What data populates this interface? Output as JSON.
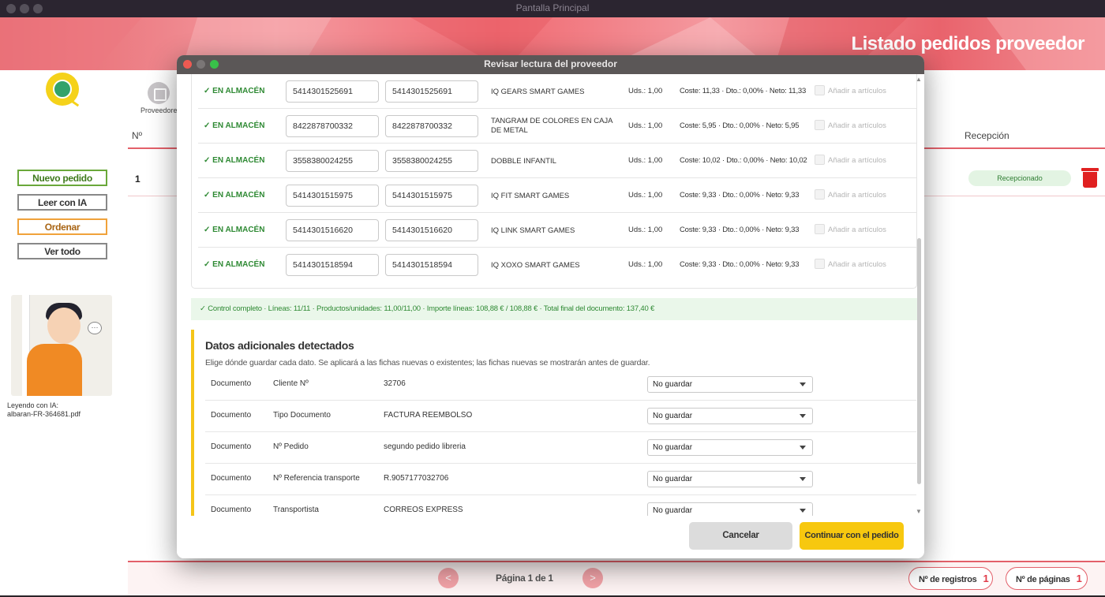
{
  "window": {
    "title": "Pantalla Principal"
  },
  "banner": {
    "title": "Listado pedidos proveedor"
  },
  "nav": {
    "proveedores_label": "Proveedores"
  },
  "table": {
    "col_no": "Nº",
    "col_recepcion": "Recepción",
    "rows": [
      {
        "no": "1",
        "status": "Recepcionado"
      }
    ]
  },
  "sidebar": {
    "nuevo_pedido": "Nuevo pedido",
    "leer_ia": "Leer con IA",
    "ordenar": "Ordenar",
    "ver_todo": "Ver todo",
    "reading_label": "Leyendo con IA:",
    "reading_file": "albaran-FR-364681.pdf"
  },
  "pagination": {
    "prev": "<",
    "next": ">",
    "page_text": "Página 1 de 1",
    "registros_label": "Nº de registros",
    "registros_value": "1",
    "paginas_label": "Nº de páginas",
    "paginas_value": "1"
  },
  "modal": {
    "title": "Revisar lectura del proveedor",
    "lines": [
      {
        "status": "✓ EN ALMACÉN",
        "code1": "5414301525691",
        "code2": "5414301525691",
        "desc": "IQ GEARS SMART GAMES",
        "uds": "Uds.: 1,00",
        "cost": "Coste: 11,33 · Dto.: 0,00% · Neto: 11,33",
        "add": "Añadir a artículos"
      },
      {
        "status": "✓ EN ALMACÉN",
        "code1": "8422878700332",
        "code2": "8422878700332",
        "desc": "TANGRAM DE COLORES EN CAJA DE METAL",
        "uds": "Uds.: 1,00",
        "cost": "Coste: 5,95 · Dto.: 0,00% · Neto: 5,95",
        "add": "Añadir a artículos"
      },
      {
        "status": "✓ EN ALMACÉN",
        "code1": "3558380024255",
        "code2": "3558380024255",
        "desc": "DOBBLE INFANTIL",
        "uds": "Uds.: 1,00",
        "cost": "Coste: 10,02 · Dto.: 0,00% · Neto: 10,02",
        "add": "Añadir a artículos"
      },
      {
        "status": "✓ EN ALMACÉN",
        "code1": "5414301515975",
        "code2": "5414301515975",
        "desc": "IQ FIT SMART GAMES",
        "uds": "Uds.: 1,00",
        "cost": "Coste: 9,33 · Dto.: 0,00% · Neto: 9,33",
        "add": "Añadir a artículos"
      },
      {
        "status": "✓ EN ALMACÉN",
        "code1": "5414301516620",
        "code2": "5414301516620",
        "desc": "IQ LINK SMART GAMES",
        "uds": "Uds.: 1,00",
        "cost": "Coste: 9,33 · Dto.: 0,00% · Neto: 9,33",
        "add": "Añadir a artículos"
      },
      {
        "status": "✓ EN ALMACÉN",
        "code1": "5414301518594",
        "code2": "5414301518594",
        "desc": "IQ XOXO SMART GAMES",
        "uds": "Uds.: 1,00",
        "cost": "Coste: 9,33 · Dto.: 0,00% · Neto: 9,33",
        "add": "Añadir a artículos"
      }
    ],
    "control": "✓ Control completo · Líneas: 11/11 · Productos/unidades: 11,00/11,00 · Importe líneas: 108,88 € / 108,88 € · Total final del documento: 137,40 €",
    "extra": {
      "title": "Datos adicionales detectados",
      "subtitle": "Elige dónde guardar cada dato. Se aplicará a las fichas nuevas o existentes; las fichas nuevas se mostrarán antes de guardar.",
      "rows": [
        {
          "scope": "Documento",
          "field": "Cliente Nº",
          "value": "32706",
          "option": "No guardar"
        },
        {
          "scope": "Documento",
          "field": "Tipo Documento",
          "value": "FACTURA REEMBOLSO",
          "option": "No guardar"
        },
        {
          "scope": "Documento",
          "field": "Nº Pedido",
          "value": "segundo pedido libreria",
          "option": "No guardar"
        },
        {
          "scope": "Documento",
          "field": "Nº Referencia transporte",
          "value": "R.9057177032706",
          "option": "No guardar"
        },
        {
          "scope": "Documento",
          "field": "Transportista",
          "value": "CORREOS EXPRESS",
          "option": "No guardar"
        }
      ]
    },
    "cancel": "Cancelar",
    "continue": "Continuar con el pedido"
  }
}
